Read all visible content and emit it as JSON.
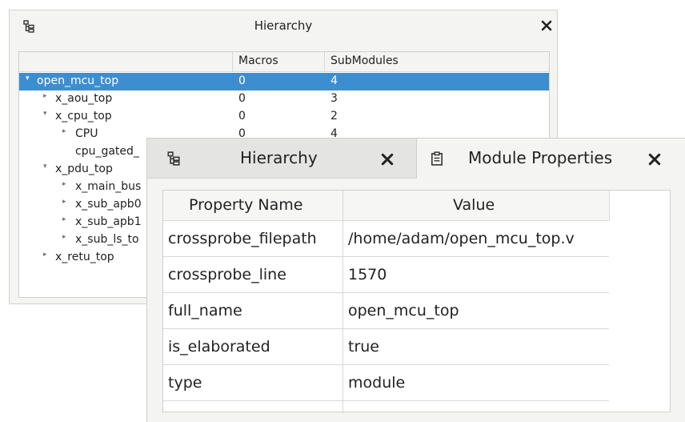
{
  "hierarchy_window": {
    "title": "Hierarchy",
    "columns": [
      "",
      "Macros",
      "SubModules"
    ],
    "rows": [
      {
        "name": "open_mcu_top",
        "arrow": "▾",
        "macros": "0",
        "submodules": "4",
        "selected": true
      },
      {
        "name": "x_aou_top",
        "arrow": "▸",
        "macros": "0",
        "submodules": "3"
      },
      {
        "name": "x_cpu_top",
        "arrow": "▾",
        "macros": "0",
        "submodules": "2"
      },
      {
        "name": "CPU",
        "arrow": "▸",
        "macros": "0",
        "submodules": "4"
      },
      {
        "name": "cpu_gated_",
        "arrow": "",
        "macros": "",
        "submodules": ""
      },
      {
        "name": "x_pdu_top",
        "arrow": "▾",
        "macros": "",
        "submodules": ""
      },
      {
        "name": "x_main_bus",
        "arrow": "▸",
        "macros": "",
        "submodules": ""
      },
      {
        "name": "x_sub_apb0",
        "arrow": "▸",
        "macros": "",
        "submodules": ""
      },
      {
        "name": "x_sub_apb1",
        "arrow": "▸",
        "macros": "",
        "submodules": ""
      },
      {
        "name": "x_sub_ls_to",
        "arrow": "▸",
        "macros": "",
        "submodules": ""
      },
      {
        "name": "x_retu_top",
        "arrow": "▸",
        "macros": "",
        "submodules": ""
      }
    ]
  },
  "front_window": {
    "tabs": [
      {
        "label": "Hierarchy"
      },
      {
        "label": "Module Properties"
      }
    ],
    "table": {
      "headers": [
        "Property Name",
        "Value"
      ],
      "rows": [
        {
          "name": "crossprobe_filepath",
          "value": "/home/adam/open_mcu_top.v"
        },
        {
          "name": "crossprobe_line",
          "value": "1570"
        },
        {
          "name": "full_name",
          "value": "open_mcu_top"
        },
        {
          "name": "is_elaborated",
          "value": "true"
        },
        {
          "name": "type",
          "value": "module"
        }
      ]
    }
  },
  "icons": {
    "hierarchy": "tree-icon",
    "properties": "clipboard-icon",
    "close": "close-icon"
  },
  "colors": {
    "selection": "#3d8ed1"
  }
}
